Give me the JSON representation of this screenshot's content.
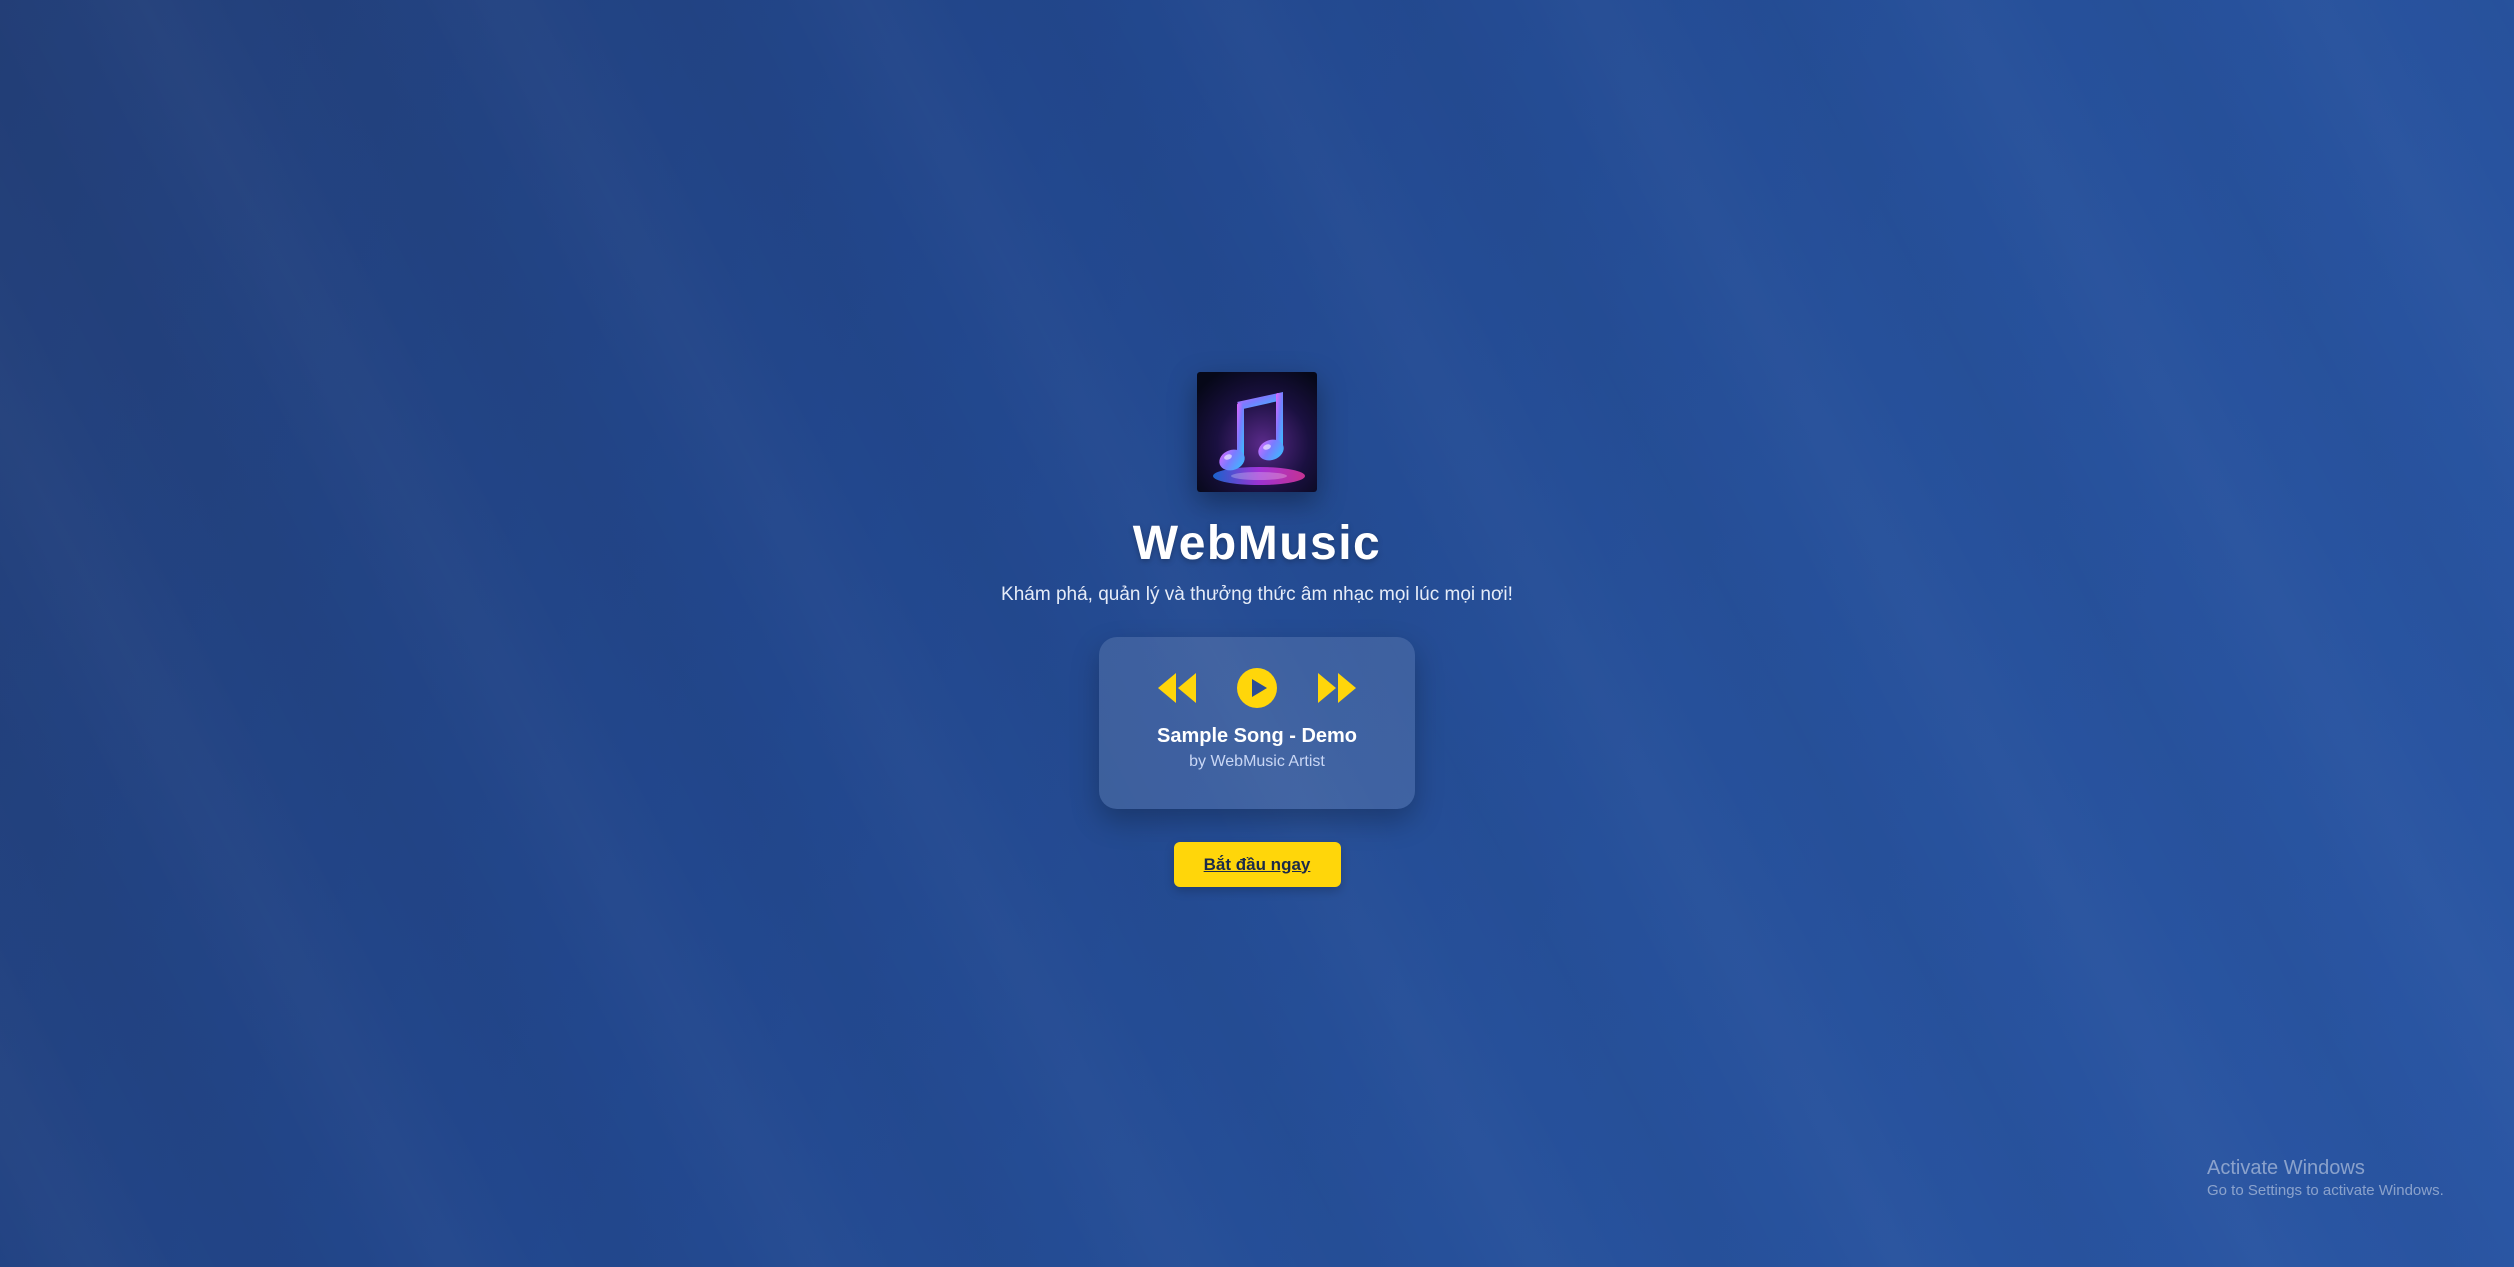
{
  "app": {
    "title": "WebMusic",
    "tagline": "Khám phá, quản lý và thưởng thức âm nhạc mọi lúc mọi nơi!"
  },
  "logo": {
    "icon": "music-note-icon"
  },
  "player": {
    "controls": [
      {
        "name": "previous",
        "icon": "rewind-icon"
      },
      {
        "name": "play",
        "icon": "play-circle-icon"
      },
      {
        "name": "next",
        "icon": "fast-forward-icon"
      }
    ],
    "song_title": "Sample Song - Demo",
    "artist": "by WebMusic Artist"
  },
  "cta": {
    "label": "Bắt đầu ngay"
  },
  "watermark": {
    "title": "Activate Windows",
    "subtitle": "Go to Settings to activate Windows."
  },
  "colors": {
    "background": "#22478d",
    "accent": "#ffd60a",
    "text": "#ffffff",
    "muted_text": "#c9d7f5"
  }
}
